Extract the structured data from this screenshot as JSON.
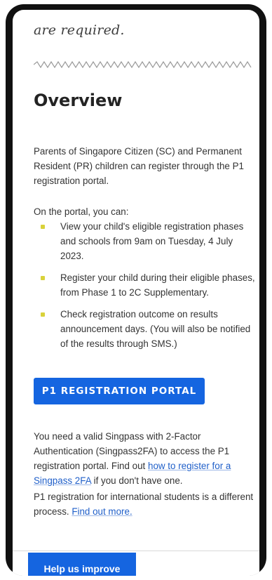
{
  "section_intro": {
    "cut_heading": "are required."
  },
  "overview": {
    "title": "Overview",
    "intro": "Parents of Singapore Citizen (SC) and Permanent Resident (PR) children can register through the P1 registration portal.",
    "portal_lead": "On the portal, you can:",
    "bullets": [
      "View your child's eligible registration phases and schools from 9am on Tuesday, 4 July 2023.",
      "Register your child during their eligible phases, from Phase 1 to 2C Supplementary.",
      "Check registration outcome on results announcement days. (You will also be notified of the results through SMS.)"
    ],
    "cta_label": "P1 REGISTRATION PORTAL",
    "singpass_text_before": "You need a valid Singpass with 2-Factor Authentication (Singpass2FA) to access the P1 registration portal. Find out ",
    "singpass_link": "how to register for a Singpass 2FA",
    "singpass_text_after": " if you don't have one.",
    "international_text": "P1 registration for international students is a different process. ",
    "international_link": "Find out more."
  },
  "footer": {
    "help_button": "Help us improve"
  },
  "colors": {
    "primary": "#1565e0",
    "bullet": "#d9d23a",
    "link": "#1f5fc9"
  }
}
